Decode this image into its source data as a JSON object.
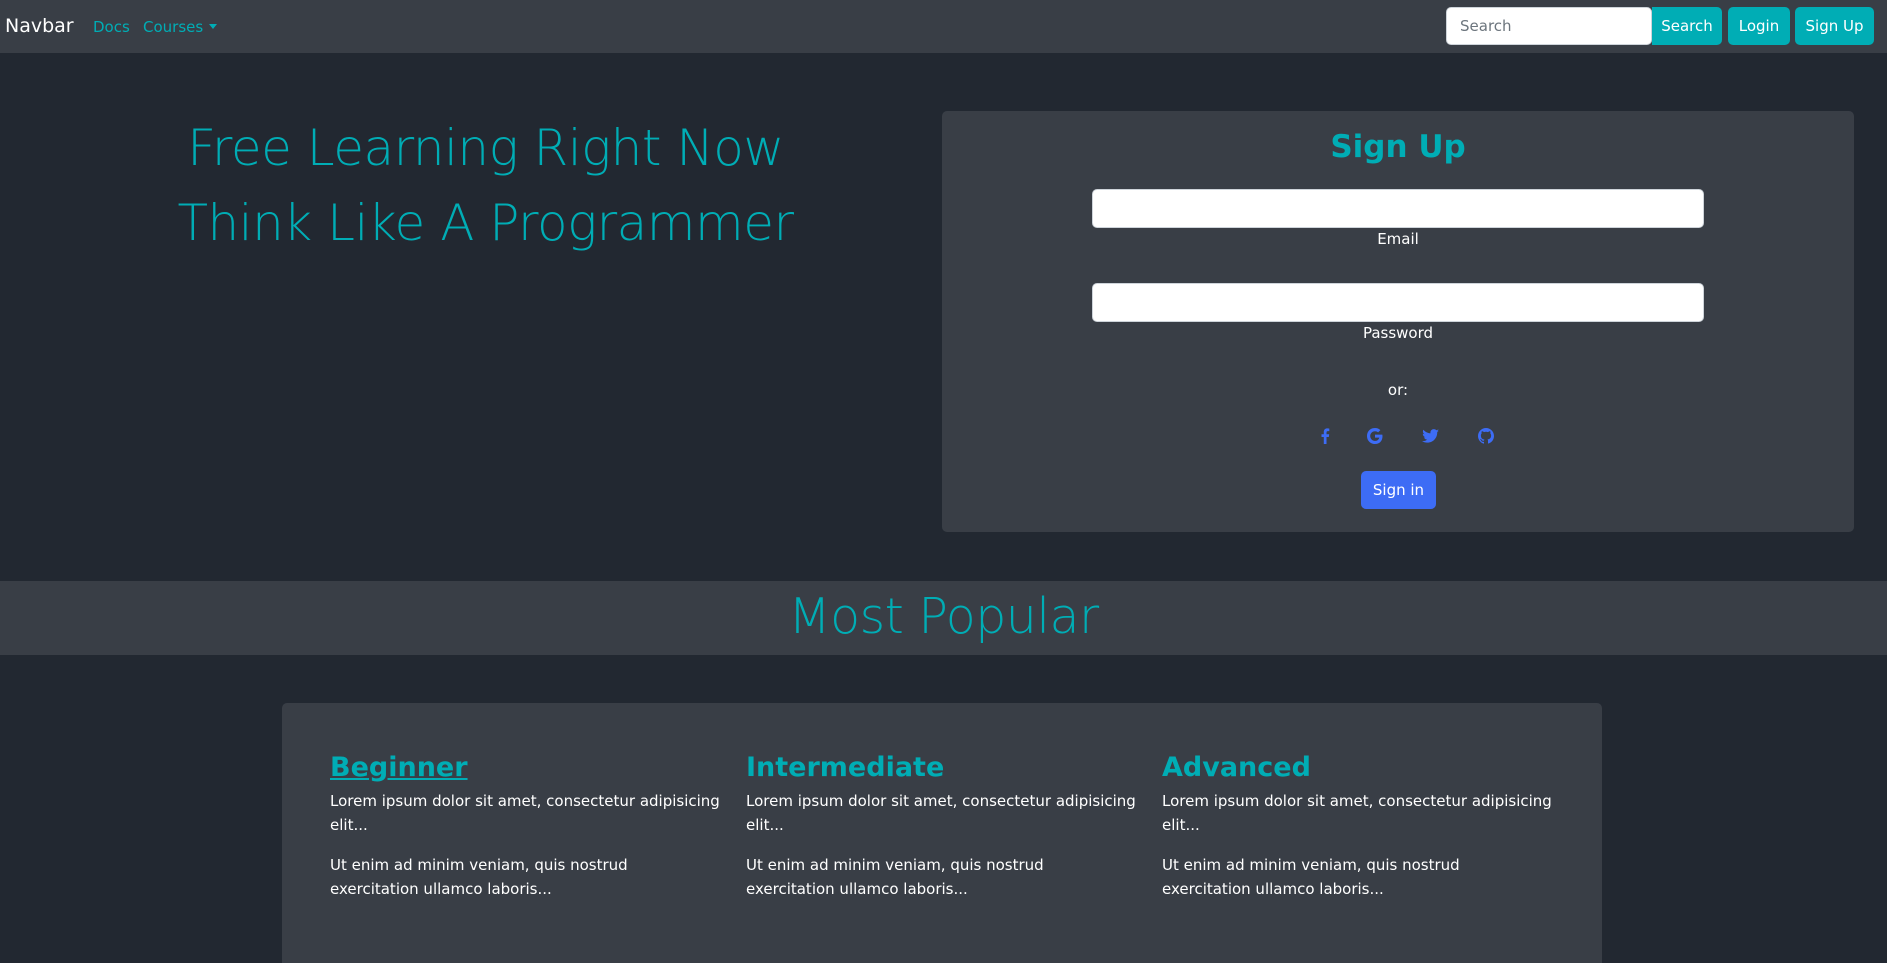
{
  "navbar": {
    "brand": "Navbar",
    "links": [
      {
        "label": "Docs"
      },
      {
        "label": "Courses"
      }
    ],
    "search_placeholder": "Search",
    "search_button": "Search",
    "login_button": "Login",
    "signup_button": "Sign Up"
  },
  "hero": {
    "line1": "Free Learning Right Now",
    "line2": "Think Like A Programmer"
  },
  "signup_form": {
    "title": "Sign Up",
    "email_label": "Email",
    "password_label": "Password",
    "or_text": "or:",
    "social_icons": [
      "facebook-icon",
      "google-icon",
      "twitter-icon",
      "github-icon"
    ],
    "signin_button": "Sign in"
  },
  "popular": {
    "title": "Most Popular",
    "courses": [
      {
        "title": "Beginner",
        "text1": "Lorem ipsum dolor sit amet, consectetur adipisicing elit...",
        "text2": "Ut enim ad minim veniam, quis nostrud exercitation ullamco laboris..."
      },
      {
        "title": "Intermediate",
        "text1": "Lorem ipsum dolor sit amet, consectetur adipisicing elit...",
        "text2": "Ut enim ad minim veniam, quis nostrud exercitation ullamco laboris..."
      },
      {
        "title": "Advanced",
        "text1": "Lorem ipsum dolor sit amet, consectetur adipisicing elit...",
        "text2": "Ut enim ad minim veniam, quis nostrud exercitation ullamco laboris..."
      }
    ]
  },
  "colors": {
    "background": "#222831",
    "surface": "#393e46",
    "accent": "#00adb5",
    "primary_button": "#3d6cf5",
    "text": "#ffffff"
  }
}
